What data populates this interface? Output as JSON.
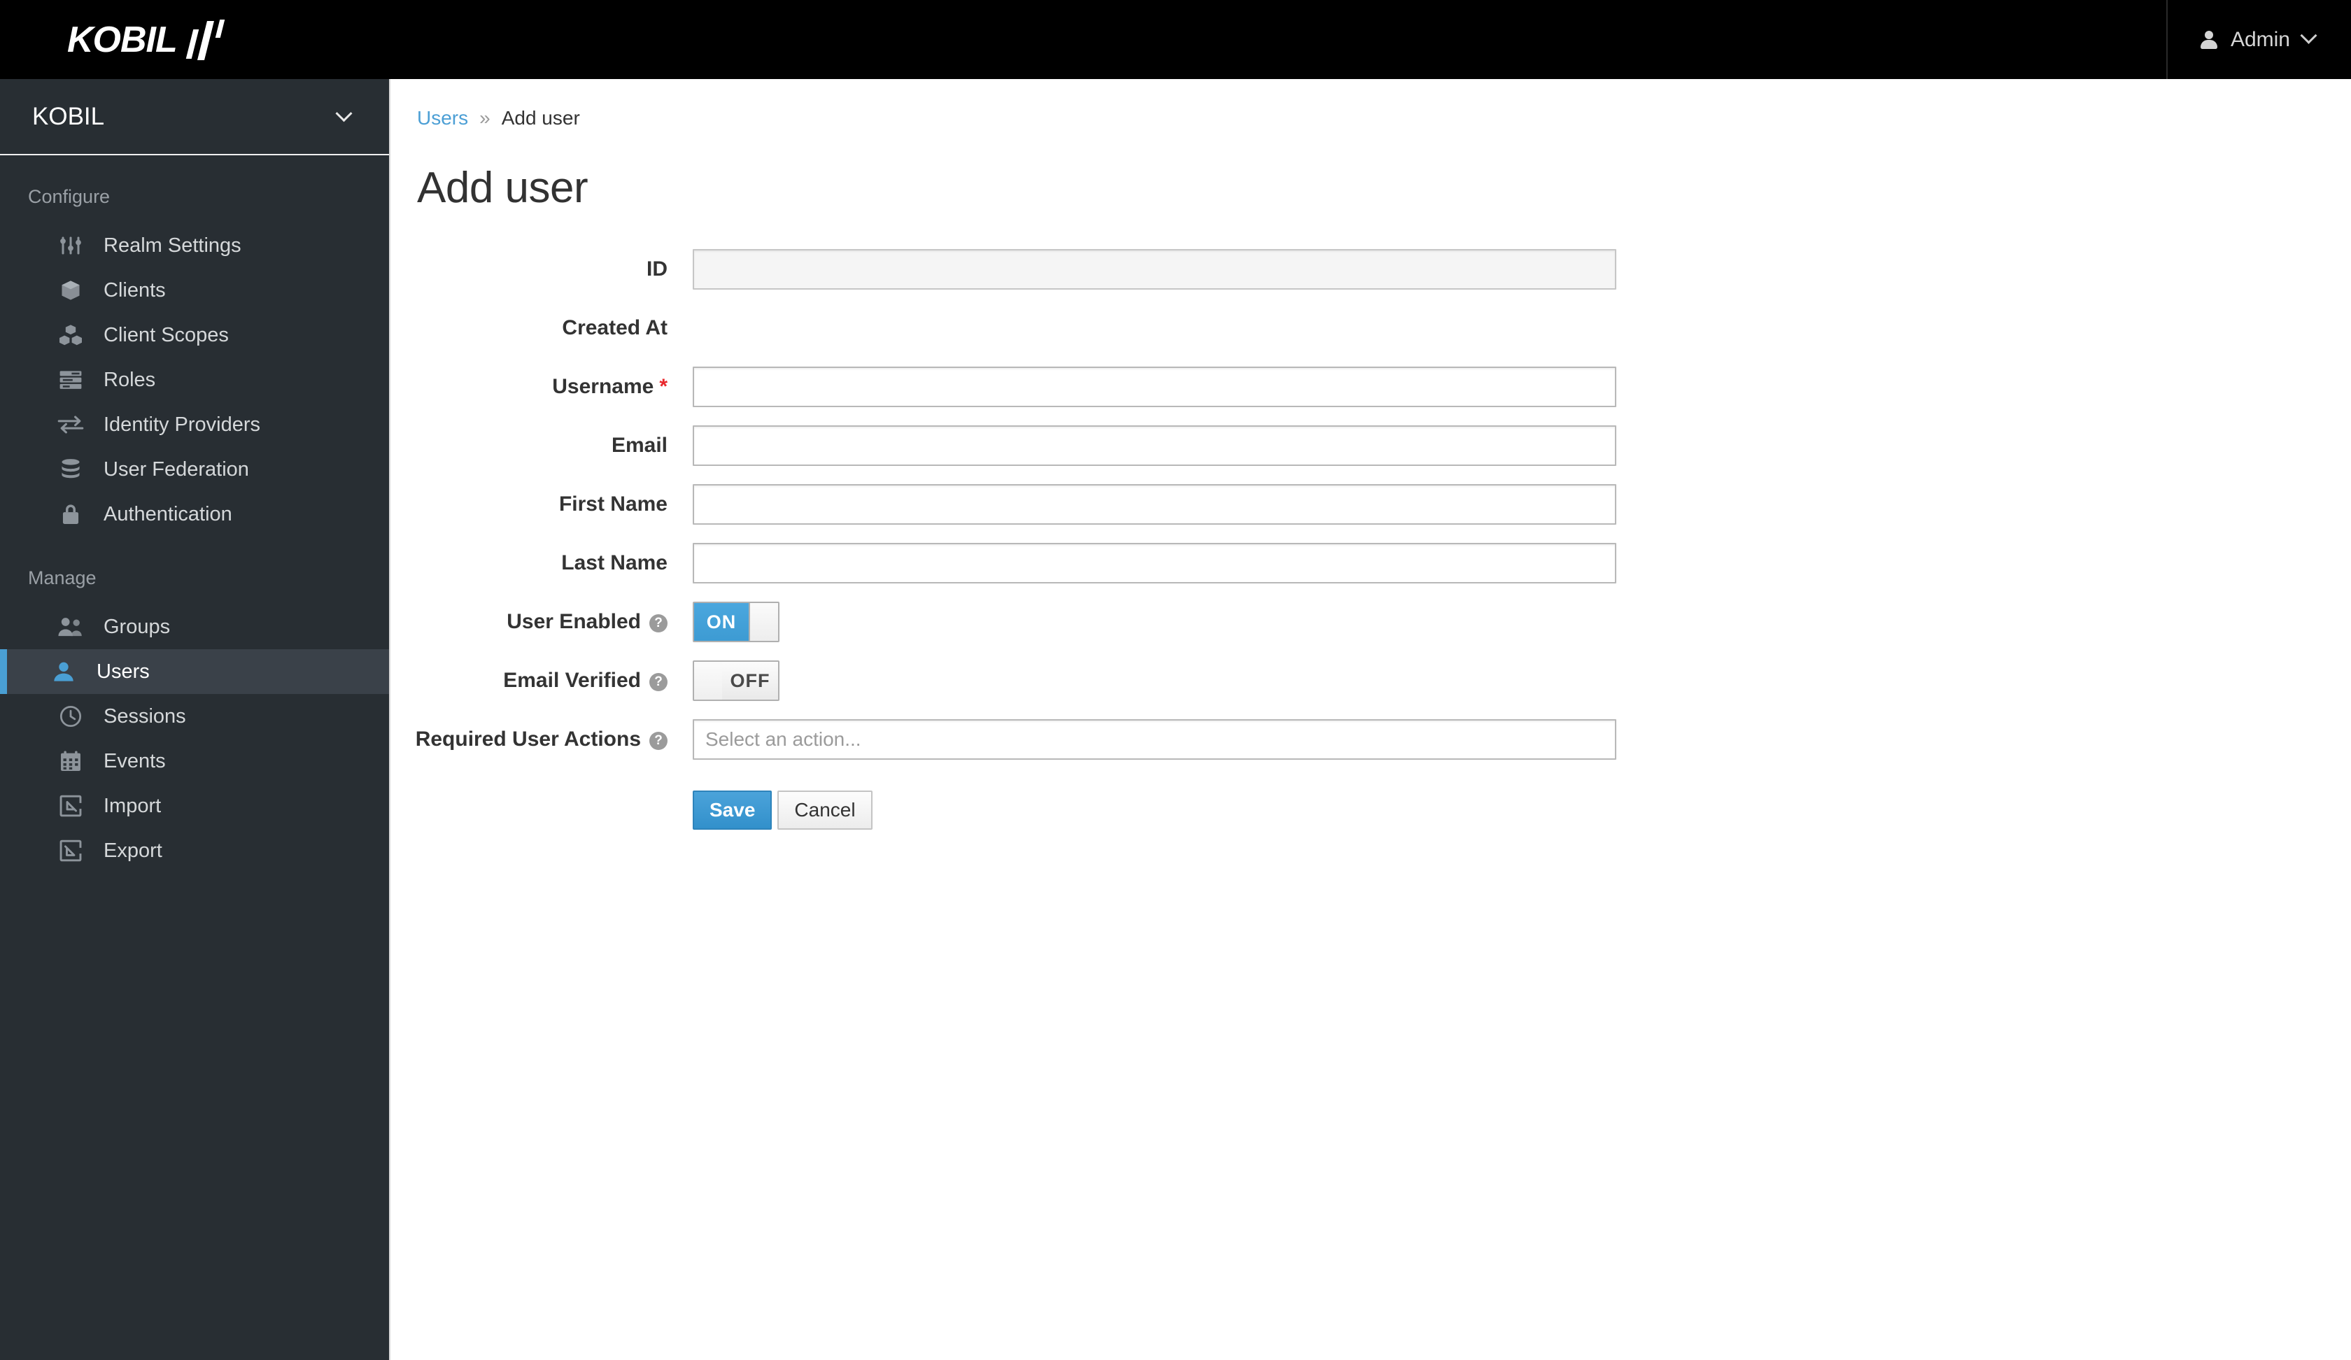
{
  "topbar": {
    "brand": "KOBIL",
    "brand_icon": "kobil-bars-logo",
    "user_icon": "user-icon",
    "user_label": "Admin",
    "chevron_icon": "chevron-down-icon"
  },
  "sidebar": {
    "realm": {
      "name": "KOBIL",
      "chevron_icon": "chevron-down-icon"
    },
    "sections": [
      {
        "title": "Configure",
        "items": [
          {
            "label": "Realm Settings",
            "icon": "sliders-icon",
            "active": false
          },
          {
            "label": "Clients",
            "icon": "cube-icon",
            "active": false
          },
          {
            "label": "Client Scopes",
            "icon": "cubes-icon",
            "active": false
          },
          {
            "label": "Roles",
            "icon": "list-icon",
            "active": false
          },
          {
            "label": "Identity Providers",
            "icon": "exchange-arrows-icon",
            "active": false
          },
          {
            "label": "User Federation",
            "icon": "database-icon",
            "active": false
          },
          {
            "label": "Authentication",
            "icon": "lock-icon",
            "active": false
          }
        ]
      },
      {
        "title": "Manage",
        "items": [
          {
            "label": "Groups",
            "icon": "users-group-icon",
            "active": false
          },
          {
            "label": "Users",
            "icon": "user-icon",
            "active": true
          },
          {
            "label": "Sessions",
            "icon": "clock-icon",
            "active": false
          },
          {
            "label": "Events",
            "icon": "calendar-icon",
            "active": false
          },
          {
            "label": "Import",
            "icon": "import-arrow-icon",
            "active": false
          },
          {
            "label": "Export",
            "icon": "export-arrow-icon",
            "active": false
          }
        ]
      }
    ]
  },
  "breadcrumb": {
    "parent": "Users",
    "separator": "»",
    "current": "Add user"
  },
  "page": {
    "title": "Add user"
  },
  "form": {
    "id": {
      "label": "ID",
      "value": "",
      "placeholder": "",
      "readonly": true
    },
    "created_at": {
      "label": "Created At",
      "value": ""
    },
    "username": {
      "label": "Username",
      "required_marker": "*",
      "value": "",
      "placeholder": ""
    },
    "email": {
      "label": "Email",
      "value": "",
      "placeholder": ""
    },
    "first_name": {
      "label": "First Name",
      "value": "",
      "placeholder": ""
    },
    "last_name": {
      "label": "Last Name",
      "value": "",
      "placeholder": ""
    },
    "user_enabled": {
      "label": "User Enabled",
      "help_icon": "help-circle-icon",
      "state": "ON",
      "on_label": "ON"
    },
    "email_verified": {
      "label": "Email Verified",
      "help_icon": "help-circle-icon",
      "state": "OFF",
      "off_label": "OFF"
    },
    "required_user_actions": {
      "label": "Required User Actions",
      "help_icon": "help-circle-icon",
      "placeholder": "Select an action...",
      "value": ""
    },
    "buttons": {
      "save": "Save",
      "cancel": "Cancel"
    }
  },
  "colors": {
    "header_bg": "#000000",
    "sidebar_bg": "#282e33",
    "sidebar_active_bg": "#3a4149",
    "accent_blue": "#4a9fd4",
    "link_blue": "#4c9fd5",
    "required_red": "#e8272c",
    "primary_button": "#3290cb"
  }
}
